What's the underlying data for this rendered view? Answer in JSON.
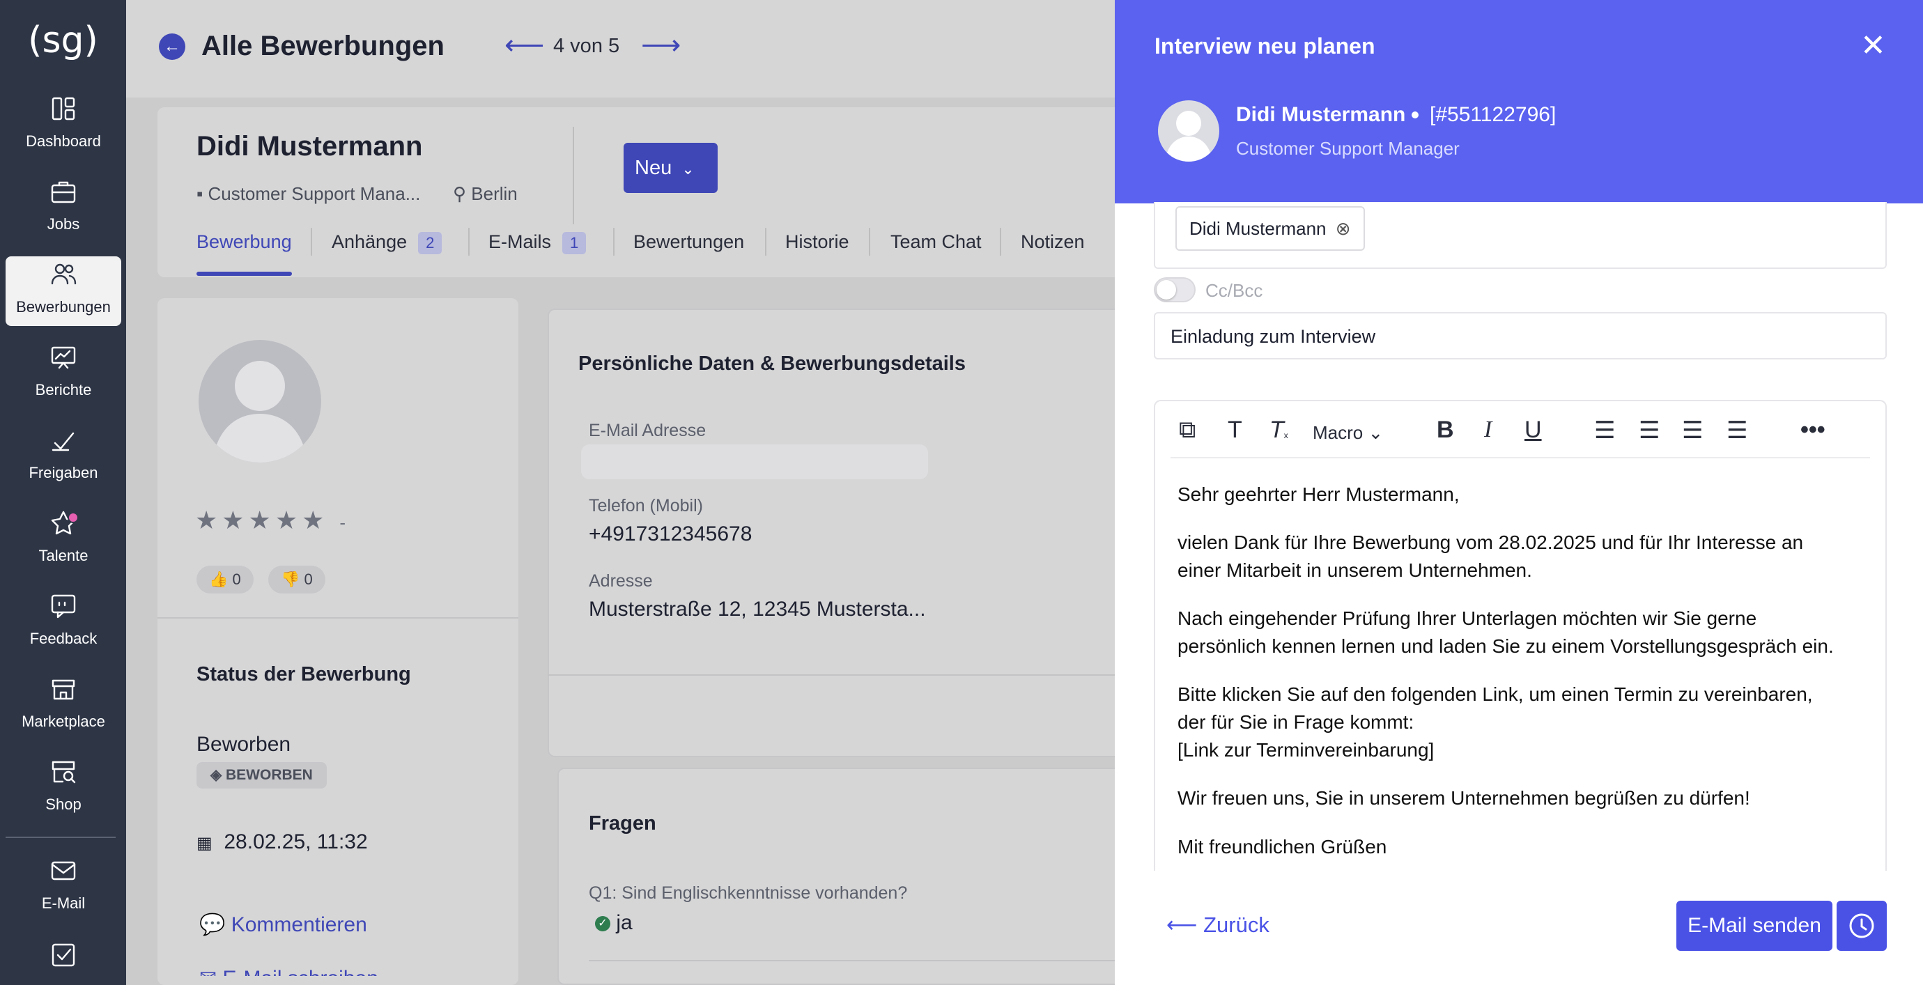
{
  "colors": {
    "brand": "#3f47b6",
    "panel_header": "#5a62ef",
    "send_button": "#4a52e6",
    "sidebar": "#2e3646"
  },
  "sidebar": {
    "logo": "(sg)",
    "items": [
      {
        "label": "Dashboard",
        "icon": "dashboard-icon"
      },
      {
        "label": "Jobs",
        "icon": "briefcase-icon"
      },
      {
        "label": "Bewerbungen",
        "icon": "users-icon"
      },
      {
        "label": "Berichte",
        "icon": "chart-board-icon"
      },
      {
        "label": "Freigaben",
        "icon": "approval-icon"
      },
      {
        "label": "Talente",
        "icon": "star-icon"
      },
      {
        "label": "Feedback",
        "icon": "feedback-icon"
      },
      {
        "label": "Marketplace",
        "icon": "store-icon"
      },
      {
        "label": "Shop",
        "icon": "shop-search-icon"
      },
      {
        "label": "E-Mail",
        "icon": "mail-icon"
      }
    ]
  },
  "header": {
    "title": "Alle Bewerbungen",
    "pager": "4 von 5"
  },
  "candidate": {
    "name": "Didi Mustermann",
    "job": "Customer Support Mana...",
    "location": "Berlin",
    "status_button": "Neu",
    "tabs": [
      {
        "label": "Bewerbung"
      },
      {
        "label": "Anhänge",
        "badge": "2"
      },
      {
        "label": "E-Mails",
        "badge": "1"
      },
      {
        "label": "Bewertungen"
      },
      {
        "label": "Historie"
      },
      {
        "label": "Team Chat"
      },
      {
        "label": "Notizen"
      }
    ],
    "rating_text": "-",
    "thumbs_up": "0",
    "thumbs_down": "0",
    "status_title": "Status der Bewerbung",
    "status_value": "Beworben",
    "status_badge": "BEWORBEN",
    "date": "28.02.25, 11:32",
    "comment_link": "Kommentieren",
    "mail_link": "E-Mail schreiben"
  },
  "details": {
    "title": "Persönliche Daten & Bewerbungsdetails",
    "email_label": "E-Mail Adresse",
    "phone_label": "Telefon (Mobil)",
    "phone": "+4917312345678",
    "address_label": "Adresse",
    "address": "Musterstraße 12, 12345 Mustersta..."
  },
  "questions": {
    "title": "Fragen",
    "q1": "Q1: Sind Englischkenntnisse vorhanden?",
    "a1": "ja"
  },
  "panel": {
    "title": "Interview neu planen",
    "name": "Didi Mustermann",
    "id": "[#551122796]",
    "job": "Customer Support Manager",
    "recipient": "Didi Mustermann",
    "ccbcc": "Cc/Bcc",
    "subject": "Einladung zum Interview",
    "macro": "Macro",
    "body": [
      "Sehr geehrter Herr Mustermann,",
      "vielen Dank für Ihre Bewerbung vom 28.02.2025 und für Ihr Interesse an",
      "einer Mitarbeit in unserem Unternehmen.",
      "Nach eingehender Prüfung Ihrer Unterlagen möchten wir Sie gerne",
      "persönlich kennen lernen und laden Sie zu einem Vorstellungsgespräch ein.",
      "Bitte klicken Sie auf den folgenden Link, um einen Termin zu vereinbaren,",
      "der für Sie in Frage kommt:",
      "[Link zur Terminvereinbarung]",
      "Wir freuen uns, Sie in unserem Unternehmen begrüßen zu dürfen!",
      "Mit freundlichen Grüßen"
    ],
    "back": "Zurück",
    "send": "E-Mail senden"
  }
}
